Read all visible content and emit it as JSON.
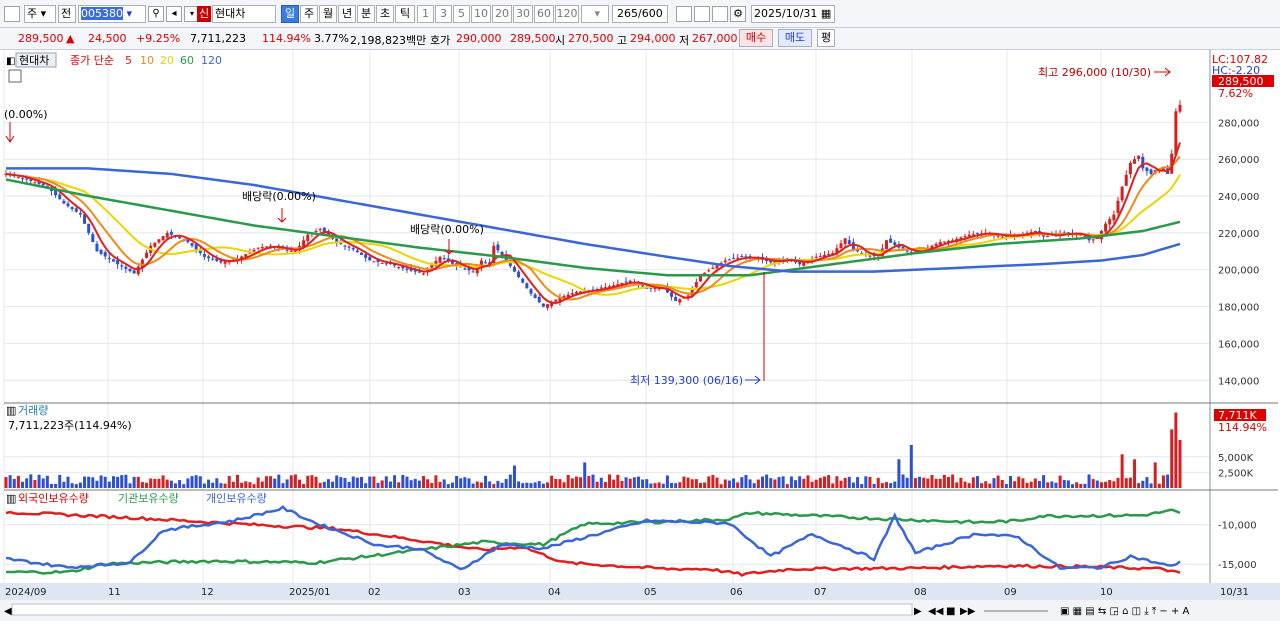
{
  "toolbar": {
    "type_select": "주",
    "range_select": "전",
    "code": "005380",
    "stock_name": "현대차",
    "market_badge": "신",
    "periods": [
      "일",
      "주",
      "월",
      "년",
      "분",
      "초",
      "틱"
    ],
    "numbers": [
      "1",
      "3",
      "5",
      "10",
      "20",
      "30",
      "60",
      "120"
    ],
    "count": "265",
    "count_total": "/600",
    "date": "2025/10/31"
  },
  "quote": {
    "price": "289,500",
    "change": "24,500",
    "rate": "+9.25%",
    "volume": "7,711,223",
    "vol_ratio": "114.94%",
    "turnover": "3.77%",
    "amount": "2,198,823백만",
    "hoga_label": "호가",
    "hoga1": "290,000",
    "hoga2": "289,500",
    "open_label": "시",
    "open": "270,500",
    "high_label": "고",
    "high": "294,000",
    "low_label": "저",
    "low": "267,000",
    "buy": "매수",
    "sell": "매도",
    "avg": "평"
  },
  "legend": {
    "name": "현대차",
    "ma_title": "종가 단순",
    "ma": [
      {
        "p": "5",
        "color": "#e02020"
      },
      {
        "p": "10",
        "color": "#f08a18"
      },
      {
        "p": "20",
        "color": "#ecd500"
      },
      {
        "p": "60",
        "color": "#2a9a4a"
      },
      {
        "p": "120",
        "color": "#3a66d8"
      }
    ]
  },
  "annotations": {
    "high": "최고 296,000 (10/30)",
    "low": "최저 139,300 (06/16)",
    "div0": "(0.00%)",
    "div1": "배당락(0.00%)",
    "div2": "배당락(0.00%)",
    "lc": "LC:107.82",
    "hc": "HC:-2.20",
    "last_price": "289,500",
    "last_pct": "7.62%"
  },
  "volume_panel": {
    "title": "거래량",
    "info": "7,711,223주(114.94%)",
    "last": "7,711K",
    "last_pct": "114.94%"
  },
  "holding_panel": {
    "s1": "외국인보유수량",
    "s2": "기관보유수량",
    "s3": "개인보유수량"
  },
  "chart_data": {
    "type": "candlestick",
    "x_tick_labels": [
      "2024/09",
      "11",
      "12",
      "2025/01",
      "02",
      "03",
      "04",
      "05",
      "06",
      "07",
      "08",
      "09",
      "10",
      "10/31"
    ],
    "price_axis": {
      "ticks": [
        "280,000",
        "260,000",
        "240,000",
        "220,000",
        "200,000",
        "180,000",
        "160,000",
        "140,000"
      ],
      "ylim": [
        132000,
        303000
      ]
    },
    "volume_axis": {
      "ticks": [
        "5,000K",
        "2,500K"
      ]
    },
    "holding_axis": {
      "ticks": [
        "-10,000",
        "-15,000"
      ]
    },
    "close_path": [
      [
        0,
        252
      ],
      [
        5,
        249
      ],
      [
        10,
        245
      ],
      [
        14,
        236
      ],
      [
        18,
        230
      ],
      [
        22,
        210
      ],
      [
        27,
        203
      ],
      [
        31,
        198
      ],
      [
        35,
        213
      ],
      [
        39,
        220
      ],
      [
        44,
        215
      ],
      [
        48,
        207
      ],
      [
        52,
        204
      ],
      [
        56,
        206
      ],
      [
        61,
        212
      ],
      [
        64,
        213
      ],
      [
        67,
        211
      ],
      [
        70,
        210
      ],
      [
        73,
        219
      ],
      [
        76,
        222
      ],
      [
        80,
        215
      ],
      [
        84,
        211
      ],
      [
        88,
        205
      ],
      [
        93,
        203
      ],
      [
        97,
        200
      ],
      [
        101,
        198
      ],
      [
        105,
        207
      ],
      [
        109,
        202
      ],
      [
        113,
        199
      ],
      [
        115,
        205
      ],
      [
        117,
        203
      ],
      [
        118,
        213
      ],
      [
        120,
        208
      ],
      [
        123,
        199
      ],
      [
        127,
        187
      ],
      [
        130,
        180
      ],
      [
        134,
        185
      ],
      [
        138,
        188
      ],
      [
        142,
        189
      ],
      [
        146,
        191
      ],
      [
        151,
        194
      ],
      [
        155,
        190
      ],
      [
        159,
        190
      ],
      [
        162,
        183
      ],
      [
        165,
        186
      ],
      [
        168,
        197
      ],
      [
        171,
        201
      ],
      [
        174,
        205
      ],
      [
        178,
        207
      ],
      [
        182,
        206
      ],
      [
        185,
        204
      ],
      [
        189,
        206
      ],
      [
        192,
        203
      ],
      [
        196,
        207
      ],
      [
        200,
        209
      ],
      [
        203,
        217
      ],
      [
        205,
        211
      ],
      [
        208,
        208
      ],
      [
        211,
        207
      ],
      [
        213,
        216
      ],
      [
        216,
        212
      ],
      [
        219,
        209
      ],
      [
        223,
        212
      ],
      [
        226,
        215
      ],
      [
        229,
        216
      ],
      [
        233,
        219
      ],
      [
        237,
        220
      ],
      [
        241,
        218
      ],
      [
        245,
        219
      ],
      [
        249,
        221
      ],
      [
        251,
        218
      ],
      [
        254,
        219
      ],
      [
        257,
        220
      ],
      [
        260,
        219
      ],
      [
        262,
        216
      ],
      [
        264,
        217
      ],
      [
        266,
        225
      ],
      [
        268,
        230
      ],
      [
        270,
        245
      ],
      [
        272,
        258
      ],
      [
        274,
        262
      ],
      [
        275,
        255
      ],
      [
        277,
        252
      ],
      [
        278,
        254
      ],
      [
        280,
        255
      ],
      [
        281,
        252
      ],
      [
        282,
        263
      ],
      [
        283,
        286
      ],
      [
        284,
        289.5
      ]
    ],
    "ma5_color": "#e02020",
    "ma10_color": "#f08a18",
    "ma20_color": "#ecd500",
    "ma60_color": "#2a9a4a",
    "ma120_color": "#3a66d8",
    "ma60_path": [
      [
        0,
        249
      ],
      [
        20,
        240
      ],
      [
        40,
        232
      ],
      [
        60,
        224
      ],
      [
        80,
        218
      ],
      [
        100,
        212
      ],
      [
        120,
        207
      ],
      [
        140,
        201
      ],
      [
        160,
        197
      ],
      [
        180,
        197
      ],
      [
        200,
        203
      ],
      [
        220,
        209
      ],
      [
        240,
        214
      ],
      [
        260,
        217
      ],
      [
        275,
        221
      ],
      [
        284,
        226
      ]
    ],
    "ma120_path": [
      [
        0,
        255
      ],
      [
        20,
        255
      ],
      [
        40,
        252
      ],
      [
        60,
        246
      ],
      [
        80,
        238
      ],
      [
        100,
        230
      ],
      [
        120,
        222
      ],
      [
        140,
        214
      ],
      [
        160,
        207
      ],
      [
        175,
        202
      ],
      [
        190,
        199
      ],
      [
        210,
        199
      ],
      [
        230,
        201
      ],
      [
        250,
        203
      ],
      [
        265,
        205
      ],
      [
        275,
        208
      ],
      [
        284,
        214
      ]
    ],
    "volume_highlight": [
      [
        123,
        3.6
      ],
      [
        140,
        4.1
      ],
      [
        216,
        4.6
      ],
      [
        219,
        6.9
      ],
      [
        270,
        5.4
      ],
      [
        273,
        4.6
      ],
      [
        278,
        4.1
      ],
      [
        282,
        9.4
      ],
      [
        283,
        12.1
      ],
      [
        284,
        7.7
      ]
    ],
    "holding_series": [
      {
        "name": "외국인보유수량",
        "color": "#e02020",
        "values": [
          [
            0,
            -8.4
          ],
          [
            30,
            -9.1
          ],
          [
            60,
            -10.0
          ],
          [
            80,
            -10.5
          ],
          [
            100,
            -12.0
          ],
          [
            115,
            -13.2
          ],
          [
            125,
            -12.8
          ],
          [
            135,
            -14.8
          ],
          [
            160,
            -15.6
          ],
          [
            170,
            -15.6
          ],
          [
            178,
            -16.3
          ],
          [
            190,
            -15.6
          ],
          [
            220,
            -15.5
          ],
          [
            240,
            -15.2
          ],
          [
            260,
            -15.3
          ],
          [
            280,
            -15.6
          ],
          [
            284,
            -16.2
          ]
        ]
      },
      {
        "name": "기관보유수량",
        "color": "#2a9a4a",
        "values": [
          [
            0,
            -16.0
          ],
          [
            15,
            -16.0
          ],
          [
            25,
            -14.9
          ],
          [
            50,
            -14.6
          ],
          [
            75,
            -14.8
          ],
          [
            100,
            -13.2
          ],
          [
            115,
            -12.2
          ],
          [
            130,
            -12.5
          ],
          [
            140,
            -9.9
          ],
          [
            160,
            -9.6
          ],
          [
            175,
            -9.3
          ],
          [
            180,
            -8.5
          ],
          [
            210,
            -9.2
          ],
          [
            235,
            -9.7
          ],
          [
            245,
            -9.5
          ],
          [
            250,
            -8.9
          ],
          [
            275,
            -8.8
          ],
          [
            282,
            -8.2
          ],
          [
            284,
            -8.6
          ]
        ]
      },
      {
        "name": "개인보유수량",
        "color": "#3a66d8",
        "values": [
          [
            0,
            -14.3
          ],
          [
            15,
            -15.4
          ],
          [
            30,
            -14.8
          ],
          [
            38,
            -10.7
          ],
          [
            55,
            -9.5
          ],
          [
            67,
            -7.9
          ],
          [
            75,
            -9.8
          ],
          [
            90,
            -12.6
          ],
          [
            100,
            -13.0
          ],
          [
            110,
            -15.7
          ],
          [
            120,
            -12.5
          ],
          [
            130,
            -13.0
          ],
          [
            140,
            -11.6
          ],
          [
            155,
            -9.5
          ],
          [
            175,
            -9.8
          ],
          [
            185,
            -14.0
          ],
          [
            195,
            -11.2
          ],
          [
            210,
            -14.3
          ],
          [
            215,
            -8.9
          ],
          [
            220,
            -13.6
          ],
          [
            235,
            -11.1
          ],
          [
            245,
            -11.6
          ],
          [
            255,
            -15.5
          ],
          [
            265,
            -15.4
          ],
          [
            272,
            -14.0
          ],
          [
            282,
            -15.3
          ],
          [
            284,
            -14.6
          ]
        ]
      }
    ]
  }
}
